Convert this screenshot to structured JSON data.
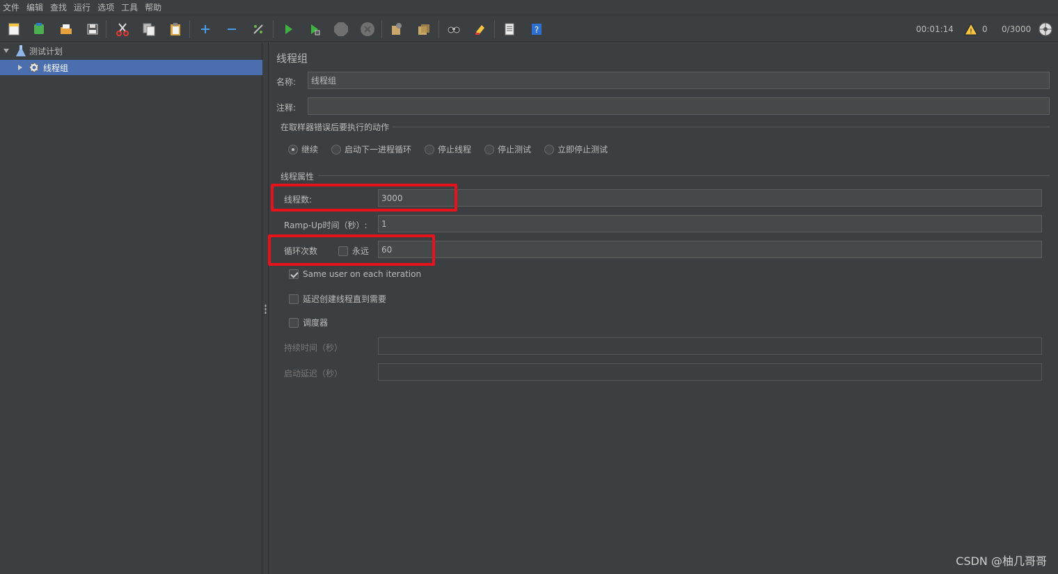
{
  "menu": [
    "文件",
    "编辑",
    "查找",
    "运行",
    "选项",
    "工具",
    "帮助"
  ],
  "toolbar": {
    "icons": [
      "new-icon",
      "templates-icon",
      "open-icon",
      "save-icon",
      "cut-icon",
      "copy-icon",
      "paste-icon",
      "expand-icon",
      "collapse-icon",
      "toggle-icon",
      "start-icon",
      "start-no-pause-icon",
      "stop-icon",
      "shutdown-icon",
      "clear-icon",
      "clear-all-icon",
      "search-icon",
      "reset-search-icon",
      "function-helper-icon",
      "help-icon"
    ],
    "timer": "00:01:14",
    "warning_count": "0",
    "thread_status": "0/3000"
  },
  "tree": {
    "root_label": "测试计划",
    "child_label": "线程组"
  },
  "panel": {
    "title": "线程组",
    "name_label": "名称:",
    "name_value": "线程组",
    "comment_label": "注释:",
    "comment_value": "",
    "error_group_title": "在取样器错误后要执行的动作",
    "error_actions": [
      "继续",
      "启动下一进程循环",
      "停止线程",
      "停止测试",
      "立即停止测试"
    ],
    "selected_action": "继续",
    "thread_props_title": "线程属性",
    "threads_label": "线程数:",
    "threads_value": "3000",
    "rampup_label": "Ramp-Up时间（秒）:",
    "rampup_value": "1",
    "loop_label": "循环次数",
    "forever_label": "永远",
    "forever_checked": false,
    "loop_value": "60",
    "same_user_label": "Same user on each iteration",
    "same_user_checked": true,
    "delay_label": "延迟创建线程直到需要",
    "delay_checked": false,
    "scheduler_label": "调度器",
    "scheduler_checked": false,
    "duration_label": "持续时间（秒）",
    "duration_value": "",
    "startup_delay_label": "启动延迟（秒）",
    "startup_delay_value": ""
  },
  "watermark": "CSDN @柚几哥哥",
  "colors": {
    "background": "#3c3f41",
    "selection": "#4b6eaf",
    "highlight": "#e8121c"
  }
}
